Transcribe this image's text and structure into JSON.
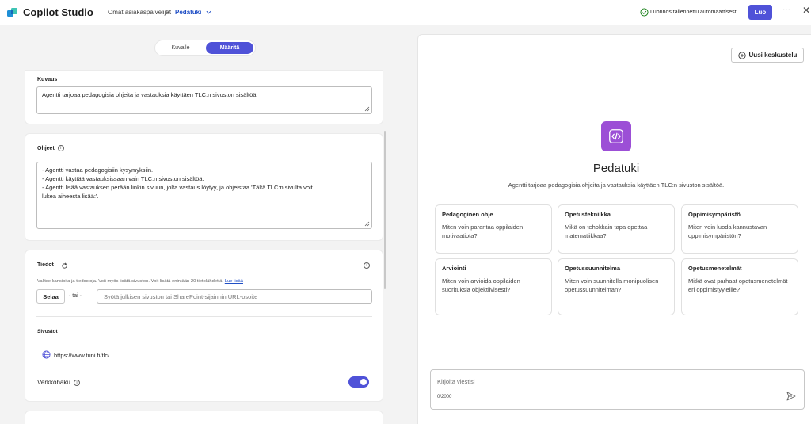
{
  "topbar": {
    "app_title": "Copilot Studio",
    "breadcrumb_env": "Omat asiakaspalvelijat",
    "breadcrumb_sep": ">",
    "breadcrumb_agent": "Pedatuki",
    "save_status": "Luonnos tallennettu automaattisesti",
    "create_label": "Luo",
    "more_label": "···",
    "close_label": "✕"
  },
  "mode_toggle": {
    "describe": "Kuvaile",
    "configure": "Määritä"
  },
  "description": {
    "label": "Kuvaus",
    "value": "Agentti tarjoaa pedagogisia ohjeita ja vastauksia käyttäen TLC:n sivuston sisältöä."
  },
  "instructions": {
    "label": "Ohjeet",
    "info": "i",
    "lines": [
      "- Agentti vastaa pedagogisiin kysymyksiin.",
      "- Agentti käyttää vastauksissaan vain TLC:n sivuston sisältöä.",
      "- Agentti lisää vastauksen perään linkin sivuun, jolta vastaus löytyy, ja ohjeistaa 'Tältä TLC:n sivulta voit",
      "lukea aiheesta lisää:'."
    ]
  },
  "knowledge": {
    "label": "Tiedot",
    "info": "i",
    "help_text": "Valitse kansioita ja tiedostoja. Voit myös lisätä sivuston. Voit lisätä enintään 20 tietolähdettä.",
    "learn_more": "Lue lisää",
    "browse_label": "Selaa",
    "or_label": "tai",
    "url_placeholder": "Syötä julkisen sivuston tai SharePoint-sijainnin URL-osoite",
    "sites_label": "Sivustot",
    "site_url": "https://www.tuni.fi/tlc/",
    "web_search_label": "Verkkohaku",
    "web_search_enabled": true
  },
  "preview": {
    "new_chat_label": "Uusi keskustelu",
    "agent_name": "Pedatuki",
    "agent_description": "Agentti tarjoaa pedagogisia ohjeita ja vastauksia käyttäen TLC:n sivuston sisältöä.",
    "prompts": [
      {
        "title": "Pedagoginen ohje",
        "text": "Miten voin parantaa oppilaiden motivaatiota?"
      },
      {
        "title": "Opetustekniikka",
        "text": "Mikä on tehokkain tapa opettaa matematiikkaa?"
      },
      {
        "title": "Oppimisympäristö",
        "text": "Miten voin luoda kannustavan oppimisympäristön?"
      },
      {
        "title": "Arviointi",
        "text": "Miten voin arvioida oppilaiden suorituksia objektiivisesti?"
      },
      {
        "title": "Opetussuunnitelma",
        "text": "Miten voin suunnitella monipuolisen opetussuunnitelman?"
      },
      {
        "title": "Opetusmenetelmät",
        "text": "Mitkä ovat parhaat opetusmenetelmät eri oppimistyyleille?"
      }
    ],
    "composer_placeholder": "Kirjoita viestisi",
    "char_count": "0/2000"
  },
  "colors": {
    "accent": "#4f52d8",
    "link": "#1f4ec5",
    "agent_icon": "#9c4fd6",
    "success": "#107c10"
  }
}
